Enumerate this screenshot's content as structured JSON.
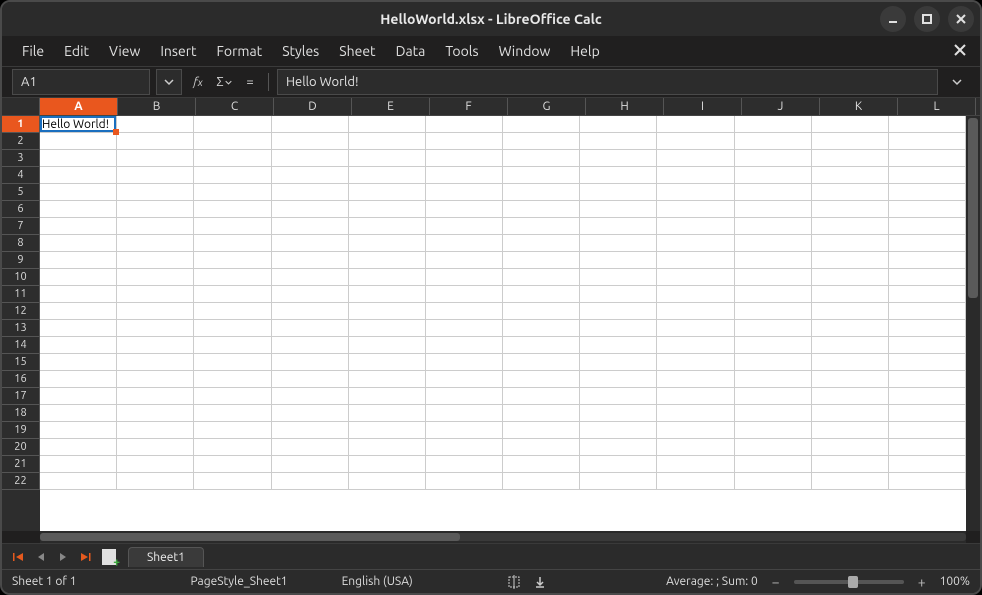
{
  "window": {
    "title": "HelloWorld.xlsx - LibreOffice Calc"
  },
  "menu": {
    "items": [
      "File",
      "Edit",
      "View",
      "Insert",
      "Format",
      "Styles",
      "Sheet",
      "Data",
      "Tools",
      "Window",
      "Help"
    ]
  },
  "formula_bar": {
    "name_box": "A1",
    "formula": "Hello World!"
  },
  "columns": [
    "A",
    "B",
    "C",
    "D",
    "E",
    "F",
    "G",
    "H",
    "I",
    "J",
    "K",
    "L"
  ],
  "rows": [
    "1",
    "2",
    "3",
    "4",
    "5",
    "6",
    "7",
    "8",
    "9",
    "10",
    "11",
    "12",
    "13",
    "14",
    "15",
    "16",
    "17",
    "18",
    "19",
    "20",
    "21",
    "22"
  ],
  "active_cell": {
    "col": "A",
    "row": "1"
  },
  "cells": {
    "A1": "Hello World!"
  },
  "sheet_tabs": {
    "active": "Sheet1"
  },
  "status": {
    "sheet_info": "Sheet 1 of 1",
    "page_style": "PageStyle_Sheet1",
    "language": "English (USA)",
    "summary": "Average: ; Sum: 0",
    "zoom": "100%"
  }
}
